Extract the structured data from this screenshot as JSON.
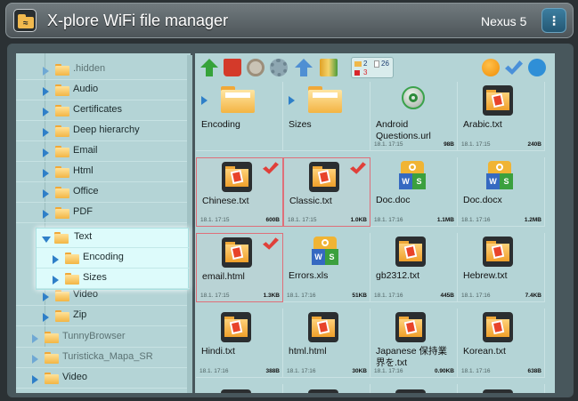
{
  "window": {
    "title": "X-plore WiFi file manager",
    "device": "Nexus 5",
    "menu_glyph": "⋮"
  },
  "tree": {
    "items": [
      {
        "label": ".hidden",
        "dim": true
      },
      {
        "label": "Audio"
      },
      {
        "label": "Certificates"
      },
      {
        "label": "Deep hierarchy"
      },
      {
        "label": "Email"
      },
      {
        "label": "Html"
      },
      {
        "label": "Office"
      },
      {
        "label": "PDF"
      },
      {
        "label": "Text",
        "expanded": true
      },
      {
        "label": "Encoding"
      },
      {
        "label": "Sizes"
      },
      {
        "label": "Video"
      },
      {
        "label": "Zip"
      },
      {
        "label": "TunnyBrowser",
        "dim": true
      },
      {
        "label": "Turisticka_Mapa_SR",
        "dim": true
      },
      {
        "label": "Video"
      }
    ]
  },
  "toolbar": {
    "folder_count": "2",
    "file_count": "26",
    "selected_count": "3"
  },
  "grid": {
    "items": [
      {
        "name": "Encoding",
        "type": "folder"
      },
      {
        "name": "Sizes",
        "type": "folder"
      },
      {
        "name": "Android Questions.url",
        "type": "url",
        "date": "18.1. 17:15",
        "size": "98B"
      },
      {
        "name": "Arabic.txt",
        "type": "text",
        "date": "18.1. 17:15",
        "size": "240B"
      },
      {
        "name": "Chinese.txt",
        "type": "text",
        "date": "18.1. 17:15",
        "size": "600B",
        "selected": true
      },
      {
        "name": "Classic.txt",
        "type": "text",
        "date": "18.1. 17:15",
        "size": "1.0KB",
        "selected": true
      },
      {
        "name": "Doc.doc",
        "type": "office",
        "date": "18.1. 17:16",
        "size": "1.1MB"
      },
      {
        "name": "Doc.docx",
        "type": "office",
        "date": "18.1. 17:16",
        "size": "1.2MB"
      },
      {
        "name": "email.html",
        "type": "text",
        "date": "18.1. 17:15",
        "size": "1.3KB",
        "selected": true
      },
      {
        "name": "Errors.xls",
        "type": "office",
        "date": "18.1. 17:16",
        "size": "51KB"
      },
      {
        "name": "gb2312.txt",
        "type": "text",
        "date": "18.1. 17:16",
        "size": "445B"
      },
      {
        "name": "Hebrew.txt",
        "type": "text",
        "date": "18.1. 17:16",
        "size": "7.4KB"
      },
      {
        "name": "Hindi.txt",
        "type": "text",
        "date": "18.1. 17:16",
        "size": "388B"
      },
      {
        "name": "html.html",
        "type": "text",
        "date": "18.1. 17:16",
        "size": "30KB"
      },
      {
        "name": "Japanese 保持業界を.txt",
        "type": "text",
        "date": "18.1. 17:16",
        "size": "0.90KB"
      },
      {
        "name": "Korean.txt",
        "type": "text",
        "date": "18.1. 17:16",
        "size": "638B"
      }
    ]
  }
}
